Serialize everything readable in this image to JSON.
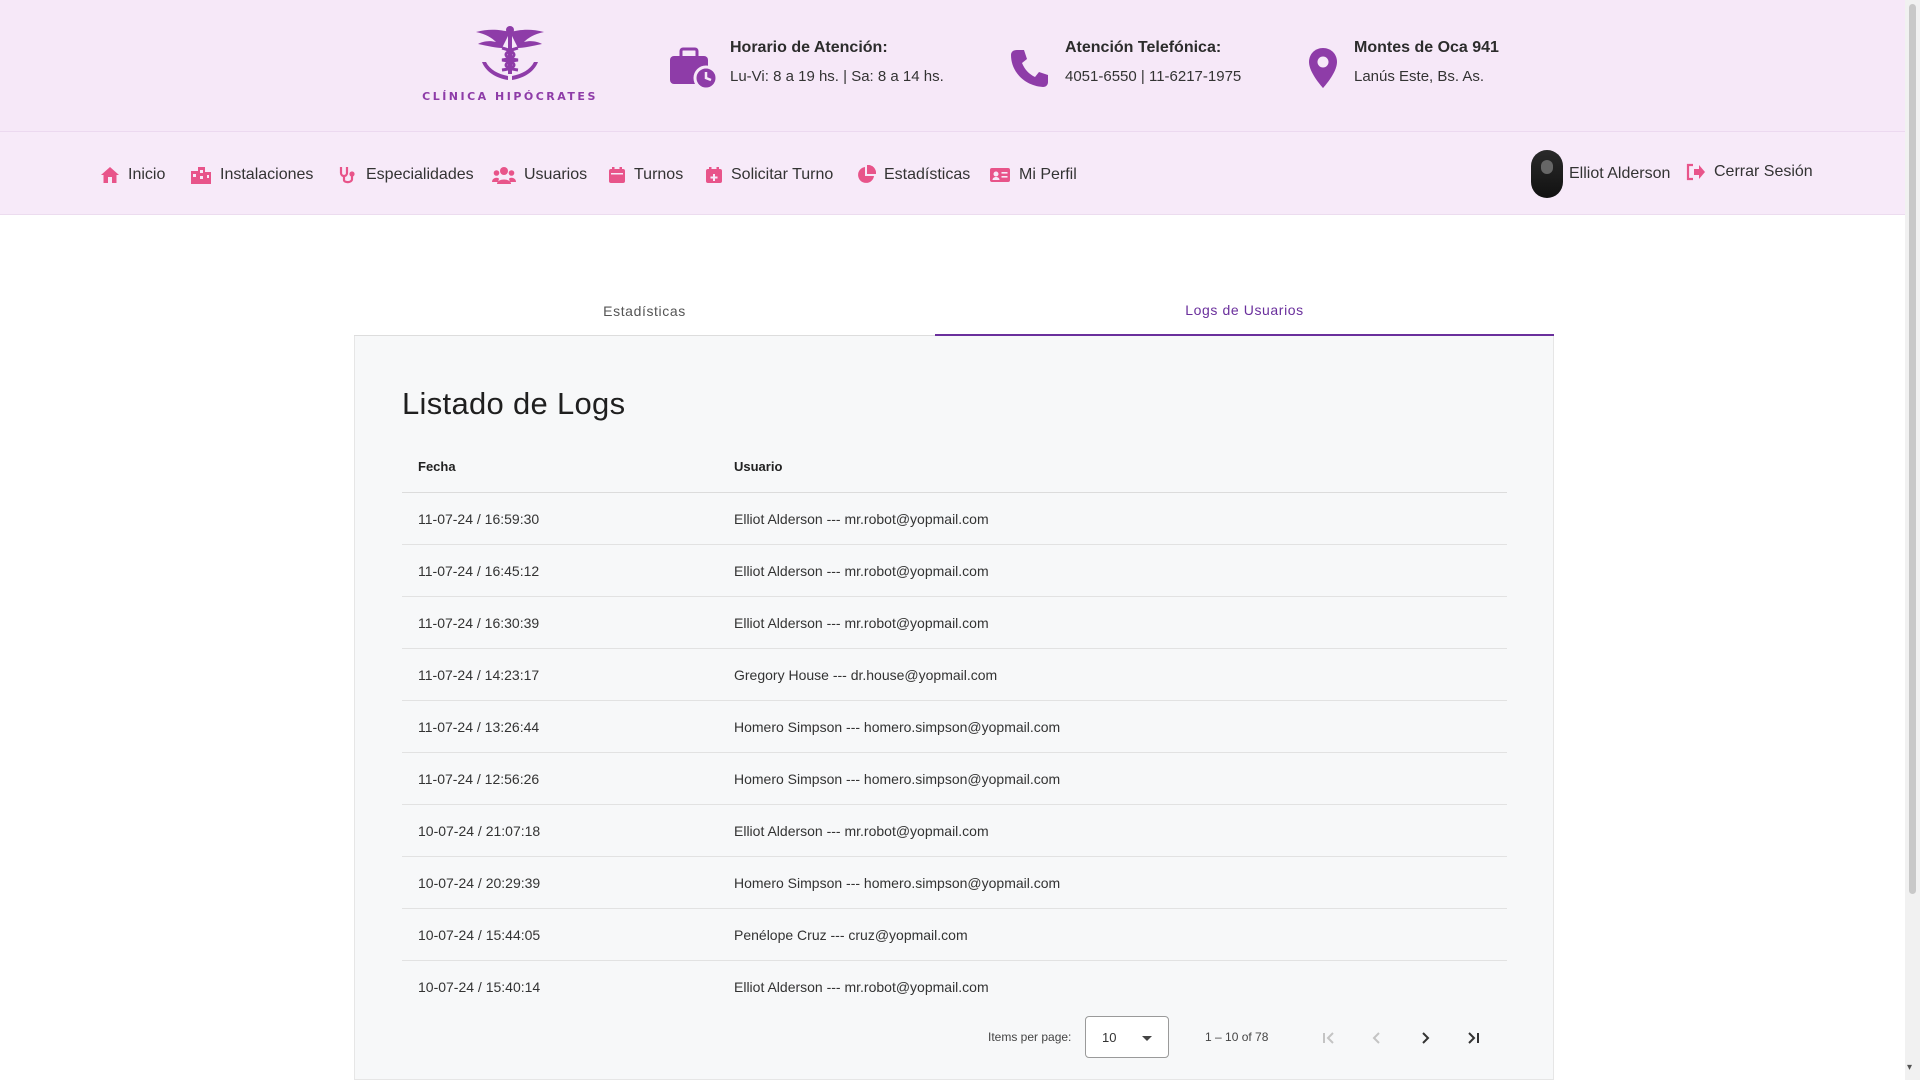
{
  "header": {
    "logo_text": "CLÍNICA HIPÓCRATES",
    "hours": {
      "title": "Horario de Atención:",
      "line": "Lu-Vi: 8 a 19 hs. | Sa: 8 a 14 hs.",
      "icon": "briefcase-clock-icon"
    },
    "phone": {
      "title": "Atención Telefónica:",
      "line": "4051-6550 | 11-6217-1975",
      "icon": "phone-icon"
    },
    "address": {
      "title": "Montes de Oca 941",
      "line": "Lanús Este, Bs. As.",
      "icon": "map-pin-icon"
    }
  },
  "nav": {
    "items": [
      {
        "label": "Inicio",
        "icon": "home-icon"
      },
      {
        "label": "Instalaciones",
        "icon": "building-icon"
      },
      {
        "label": "Especialidades",
        "icon": "stethoscope-icon"
      },
      {
        "label": "Usuarios",
        "icon": "users-icon"
      },
      {
        "label": "Turnos",
        "icon": "calendar-icon"
      },
      {
        "label": "Solicitar Turno",
        "icon": "calendar-plus-icon"
      },
      {
        "label": "Estadísticas",
        "icon": "pie-chart-icon"
      },
      {
        "label": "Mi Perfil",
        "icon": "id-card-icon"
      }
    ],
    "user_name": "Elliot Alderson",
    "logout_label": "Cerrar Sesión"
  },
  "tabs": [
    {
      "label": "Estadísticas",
      "active": false
    },
    {
      "label": "Logs de Usuarios",
      "active": true
    }
  ],
  "logs": {
    "title": "Listado de Logs",
    "columns": [
      "Fecha",
      "Usuario"
    ],
    "rows": [
      {
        "fecha": "11-07-24 / 16:59:30",
        "usuario": "Elliot Alderson --- mr.robot@yopmail.com"
      },
      {
        "fecha": "11-07-24 / 16:45:12",
        "usuario": "Elliot Alderson --- mr.robot@yopmail.com"
      },
      {
        "fecha": "11-07-24 / 16:30:39",
        "usuario": "Elliot Alderson --- mr.robot@yopmail.com"
      },
      {
        "fecha": "11-07-24 / 14:23:17",
        "usuario": "Gregory House --- dr.house@yopmail.com"
      },
      {
        "fecha": "11-07-24 / 13:26:44",
        "usuario": "Homero Simpson --- homero.simpson@yopmail.com"
      },
      {
        "fecha": "11-07-24 / 12:56:26",
        "usuario": "Homero Simpson --- homero.simpson@yopmail.com"
      },
      {
        "fecha": "10-07-24 / 21:07:18",
        "usuario": "Elliot Alderson --- mr.robot@yopmail.com"
      },
      {
        "fecha": "10-07-24 / 20:29:39",
        "usuario": "Homero Simpson --- homero.simpson@yopmail.com"
      },
      {
        "fecha": "10-07-24 / 15:44:05",
        "usuario": "Penélope Cruz --- cruz@yopmail.com"
      },
      {
        "fecha": "10-07-24 / 15:40:14",
        "usuario": "Elliot Alderson --- mr.robot@yopmail.com"
      }
    ]
  },
  "paginator": {
    "items_per_page_label": "Items per page:",
    "items_per_page_value": "10",
    "range_label": "1 – 10 of 78"
  },
  "colors": {
    "accent": "#6a2f9c",
    "brand": "#8e3ca8",
    "nav_icon": "#e8548a",
    "header_bg": "#f6e8f8"
  }
}
